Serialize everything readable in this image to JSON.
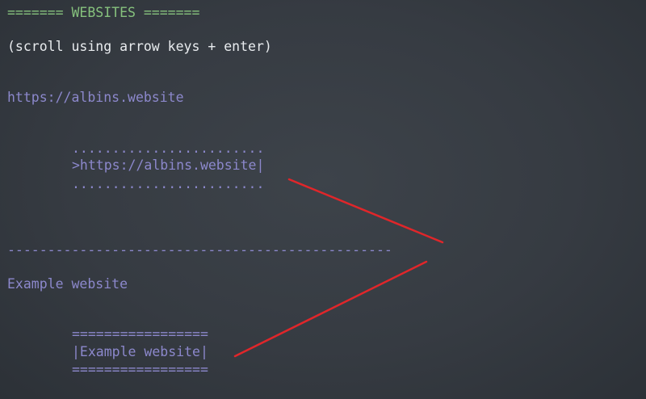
{
  "header": {
    "title": "======= WEBSITES ======="
  },
  "hint": "(scroll using arrow keys + enter)",
  "items": [
    {
      "url": "https://albins.website",
      "box_top": "........................",
      "box_middle": ">https://albins.website|",
      "box_bottom": "........................"
    },
    {
      "url": "Example website",
      "box_top": "=================",
      "box_middle": "|Example website|",
      "box_bottom": "================="
    }
  ],
  "separator": "------------------------------------------------",
  "colors": {
    "background": "#373c43",
    "header": "#86c17d",
    "text": "#e9ecef",
    "link": "#8c88cc",
    "annotation": "#e0262a"
  }
}
